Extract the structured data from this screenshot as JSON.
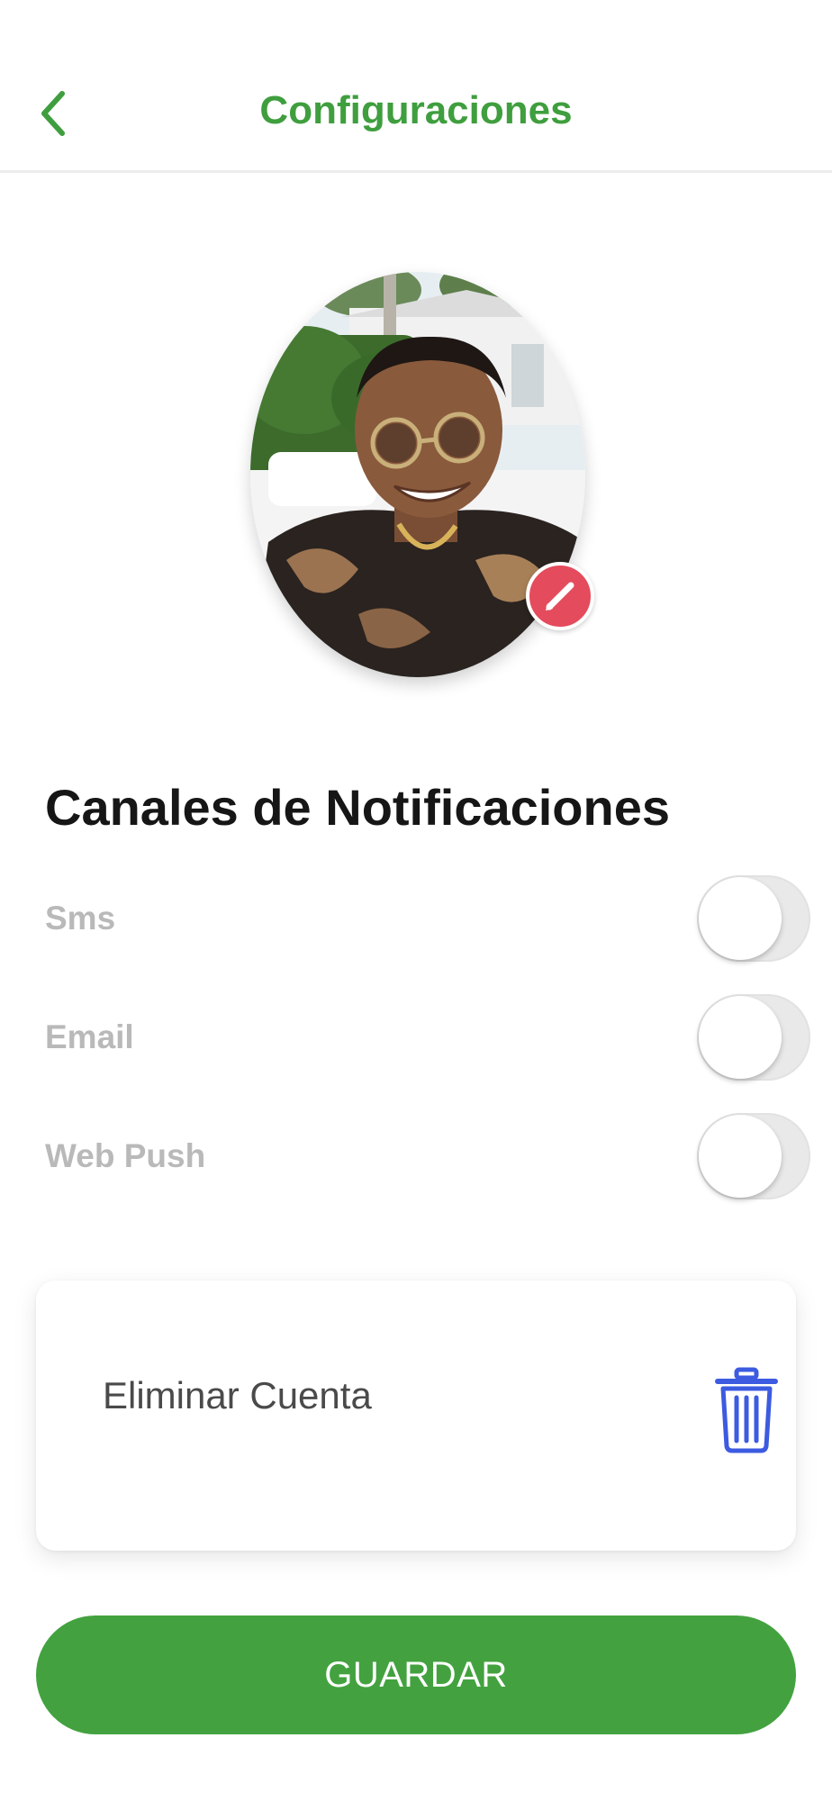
{
  "header": {
    "title": "Configuraciones",
    "back_icon": "chevron-left-icon",
    "accent_color": "#3f9e3e"
  },
  "profile": {
    "avatar": "profile-photo",
    "edit_icon": "pencil-icon",
    "edit_badge_color": "#e44b5c"
  },
  "notifications": {
    "title": "Canales de Notificaciones",
    "channels": [
      {
        "label": "Sms",
        "enabled": false
      },
      {
        "label": "Email",
        "enabled": false
      },
      {
        "label": "Web Push",
        "enabled": false
      }
    ]
  },
  "account": {
    "delete_label": "Eliminar Cuenta",
    "delete_icon": "trash-icon",
    "icon_color": "#3c5be0"
  },
  "actions": {
    "save_label": "GUARDAR",
    "save_color": "#43a23f"
  }
}
